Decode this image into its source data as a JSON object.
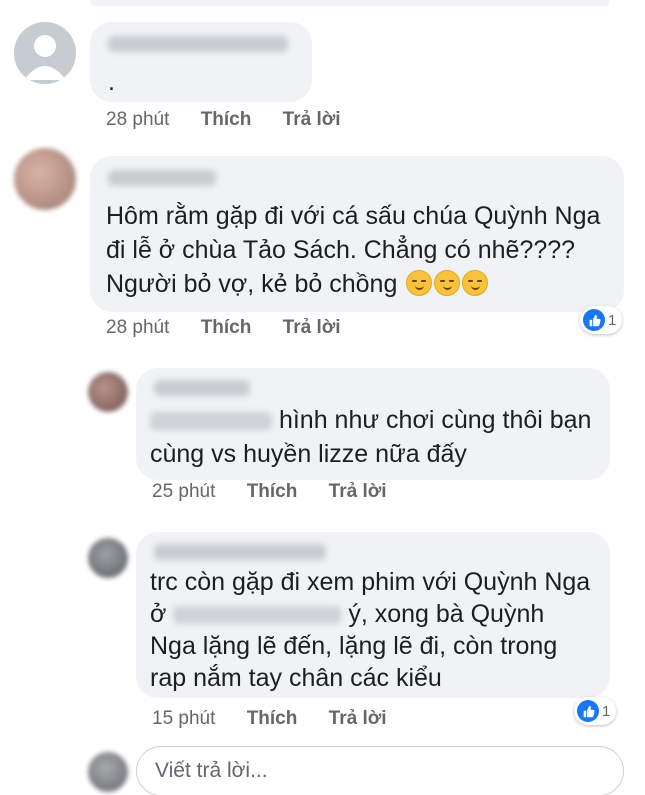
{
  "comments": [
    {
      "text_lines": [
        "."
      ],
      "time": "28 phút",
      "like_label": "Thích",
      "reply_label": "Trả lời"
    },
    {
      "text_lines": [
        "Hôm rằm gặp đi với cá sấu chúa Quỳnh Nga",
        "đi lễ ở chùa Tảo Sách. Chẳng có nhẽ????",
        "Người bỏ vợ, kẻ bỏ chồng"
      ],
      "emoji": [
        "smirk-emoji",
        "smirk-emoji",
        "smirk-emoji"
      ],
      "time": "28 phút",
      "like_label": "Thích",
      "reply_label": "Trả lời",
      "reaction_count": "1"
    },
    {
      "text_lines": [
        "hình như chơi cùng thôi bạn",
        "cùng vs huyền lizze nữa đấy"
      ],
      "time": "25 phút",
      "like_label": "Thích",
      "reply_label": "Trả lời"
    },
    {
      "text_lines": [
        "trc còn gặp đi xem phim với Quỳnh Nga",
        "ý, xong bà Quỳnh",
        "Nga lặng lẽ đến, lặng lẽ đi, còn trong",
        "rap nắm tay chân các kiểu"
      ],
      "time": "15 phút",
      "like_label": "Thích",
      "reply_label": "Trả lời",
      "reaction_count": "1"
    }
  ],
  "reply_box": {
    "placeholder": "Viết trả lời..."
  },
  "colors": {
    "bubble": "#f0f2f5",
    "meta": "#65676b",
    "like_blue": "#1877f2"
  },
  "icons": {
    "reaction": "like-icon",
    "default_avatar": "user-silhouette-icon"
  }
}
